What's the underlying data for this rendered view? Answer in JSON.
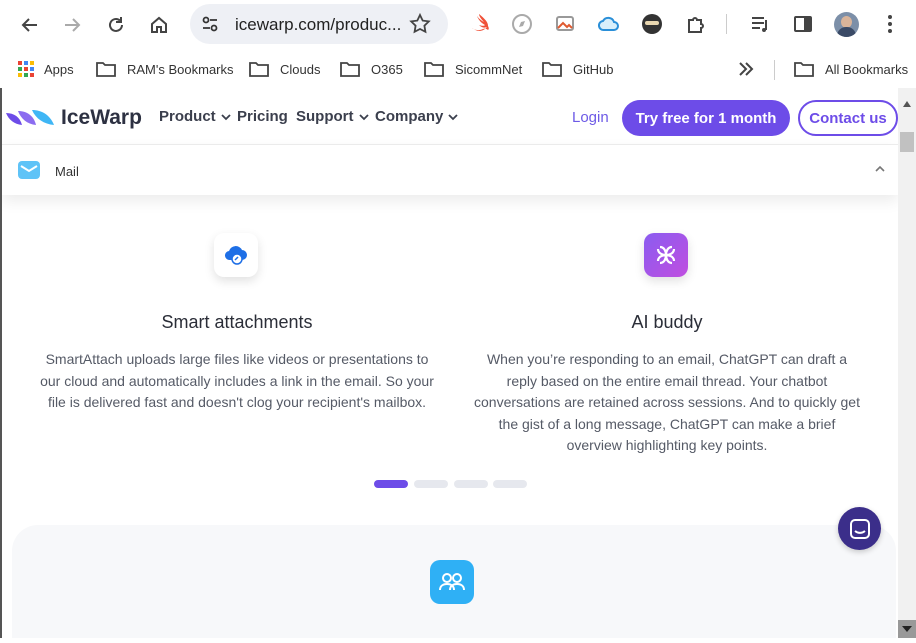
{
  "browser": {
    "url": "icewarp.com/produc...",
    "bookmarks": [
      {
        "label": "Apps"
      },
      {
        "label": "RAM's Bookmarks"
      },
      {
        "label": "Clouds"
      },
      {
        "label": "O365"
      },
      {
        "label": "SicommNet"
      },
      {
        "label": "GitHub"
      },
      {
        "label": "All Bookmarks"
      }
    ]
  },
  "site": {
    "brand": "IceWarp",
    "nav": [
      {
        "label": "Product"
      },
      {
        "label": "Pricing"
      },
      {
        "label": "Support"
      },
      {
        "label": "Company"
      }
    ],
    "login": "Login",
    "try_free": "Try free for 1 month",
    "contact": "Contact us",
    "subnav_label": "Mail",
    "brand_color": "#6d4ce8"
  },
  "features": [
    {
      "icon": "cloud-attachment-icon",
      "title": "Smart attachments",
      "desc": "SmartAttach uploads large files like videos or presentations to our cloud and automatically includes a link in the email. So your file is delivered fast and doesn't clog your recipient's mailbox."
    },
    {
      "icon": "ai-knot-icon",
      "title": "AI buddy",
      "desc": "When you’re responding to an email, ChatGPT can draft a reply based on the entire email thread. Your chatbot conversations are retained across sessions. And to quickly get the gist of a long message, ChatGPT can make a brief overview highlighting key points."
    }
  ],
  "carousel": {
    "pages": 4,
    "active": 1
  }
}
